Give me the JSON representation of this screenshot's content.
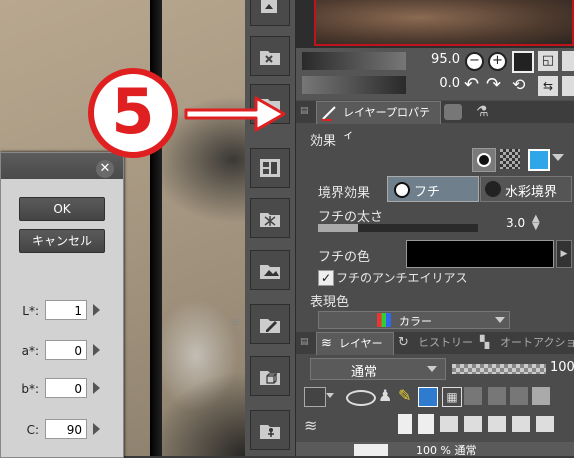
{
  "annotation": {
    "step_number": "5",
    "accent": "#e02020"
  },
  "dialog": {
    "ok_label": "OK",
    "cancel_label": "キャンセル",
    "fields": [
      {
        "label": "L*:",
        "value": "1"
      },
      {
        "label": "a*:",
        "value": "0"
      },
      {
        "label": "b*:",
        "value": "0"
      },
      {
        "label": "C:",
        "value": "90"
      }
    ]
  },
  "navigator": {
    "zoom": "95.0",
    "rotate": "0.0"
  },
  "layer_property": {
    "tab_label": "レイヤープロパティ",
    "effect_label": "効果",
    "border_effect_label": "境界効果",
    "border_option": "フチ",
    "watercolor_option": "水彩境界",
    "thickness_label": "フチの太さ",
    "thickness_value": "3.0",
    "color_label": "フチの色",
    "color_value": "#000000",
    "antialias_label": "フチのアンチエイリアス",
    "express_color_label": "表現色",
    "express_color_value": "カラー"
  },
  "layer_panel": {
    "tabs": [
      "レイヤー",
      "ヒストリー",
      "オートアクション"
    ],
    "blend_mode": "通常",
    "opacity": "100",
    "layer_row_text": "100 % 通常"
  }
}
